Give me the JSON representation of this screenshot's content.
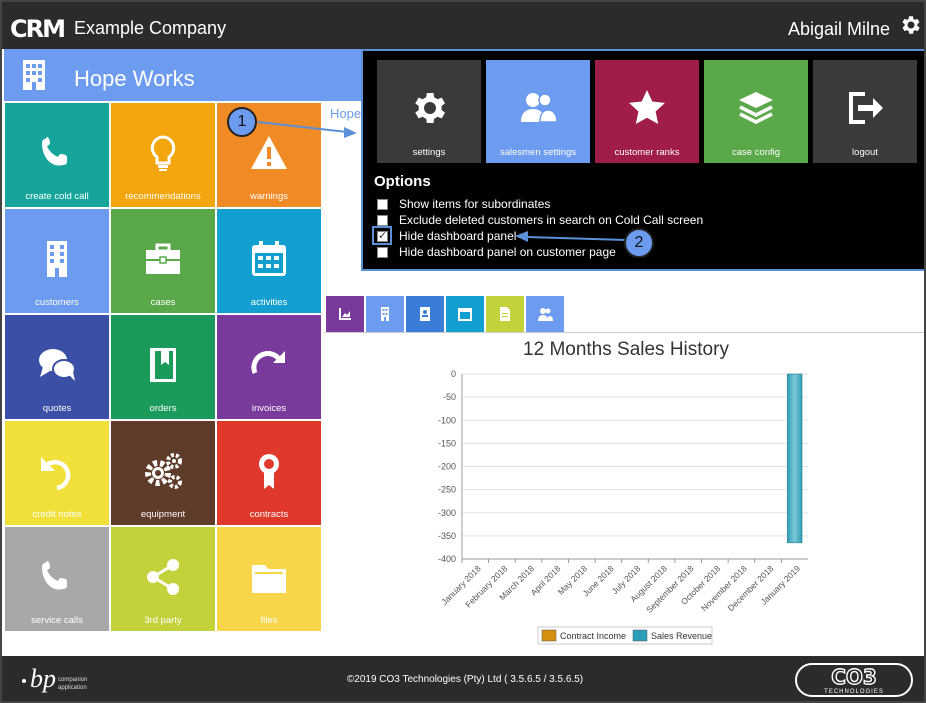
{
  "topbar": {
    "logo": "CRM",
    "company": "Example Company",
    "user": "Abigail Milne"
  },
  "dashboard": {
    "title": "Hope Works"
  },
  "tiles": [
    {
      "label": "create cold call",
      "color": "#16a59a",
      "icon": "phone-icon"
    },
    {
      "label": "recommendations",
      "color": "#f2a50c",
      "icon": "lightbulb-icon"
    },
    {
      "label": "warnings",
      "color": "#f08a24",
      "icon": "warning-icon"
    },
    {
      "label": "customers",
      "color": "#6c9bef",
      "icon": "building-icon"
    },
    {
      "label": "cases",
      "color": "#5ba84a",
      "icon": "briefcase-icon"
    },
    {
      "label": "activities",
      "color": "#139fcf",
      "icon": "calendar-icon"
    },
    {
      "label": "quotes",
      "color": "#3a4fa5",
      "icon": "chat-icon"
    },
    {
      "label": "orders",
      "color": "#1a9a5b",
      "icon": "book-icon"
    },
    {
      "label": "invoices",
      "color": "#7a3a9c",
      "icon": "redo-icon"
    },
    {
      "label": "credit notes",
      "color": "#f2e03a",
      "icon": "undo-icon"
    },
    {
      "label": "equipment",
      "color": "#5f3b2a",
      "icon": "gears-icon"
    },
    {
      "label": "contracts",
      "color": "#e0392b",
      "icon": "ribbon-icon"
    },
    {
      "label": "service calls",
      "color": "#a8a8a8",
      "icon": "phone-icon"
    },
    {
      "label": "3rd party",
      "color": "#c3d13b",
      "icon": "share-icon"
    },
    {
      "label": "files",
      "color": "#f7d64a",
      "icon": "folder-icon"
    }
  ],
  "breadcrumb": "Hope",
  "popup": {
    "tiles": [
      {
        "label": "settings",
        "color": "#3a3a3a",
        "icon": "gear-icon"
      },
      {
        "label": "salesmen settings",
        "color": "#6c9bef",
        "icon": "users-icon"
      },
      {
        "label": "customer ranks",
        "color": "#a01d4a",
        "icon": "star-icon"
      },
      {
        "label": "case config",
        "color": "#5ba84a",
        "icon": "layers-icon"
      },
      {
        "label": "logout",
        "color": "#3a3a3a",
        "icon": "logout-icon"
      }
    ],
    "options_title": "Options",
    "options": [
      {
        "label": "Show items for subordinates",
        "checked": false
      },
      {
        "label": "Exclude deleted customers in search on Cold Call screen",
        "checked": false
      },
      {
        "label": "Hide dashboard panel",
        "checked": true
      },
      {
        "label": "Hide dashboard panel on customer page",
        "checked": false
      }
    ]
  },
  "callouts": [
    "1",
    "2"
  ],
  "tabs": [
    {
      "color": "#7a3a9c",
      "icon": "chart-icon"
    },
    {
      "color": "#6c9bef",
      "icon": "building-icon"
    },
    {
      "color": "#3a7dd8",
      "icon": "contact-book-icon"
    },
    {
      "color": "#139fcf",
      "icon": "calendar-icon"
    },
    {
      "color": "#c3d13b",
      "icon": "document-icon"
    },
    {
      "color": "#6c9bef",
      "icon": "users-icon"
    }
  ],
  "chart_data": {
    "type": "bar",
    "title": "12 Months Sales History",
    "categories": [
      "January 2018",
      "February 2018",
      "March 2018",
      "April 2018",
      "May 2018",
      "June 2018",
      "July 2018",
      "August 2018",
      "September 2018",
      "October 2018",
      "November 2018",
      "December 2018",
      "January 2019"
    ],
    "series": [
      {
        "name": "Contract Income",
        "color": "#d4900f",
        "values": [
          0,
          0,
          0,
          0,
          0,
          0,
          0,
          0,
          0,
          0,
          0,
          0,
          0
        ]
      },
      {
        "name": "Sales Revenue",
        "color": "#2e9fb8",
        "values": [
          0,
          0,
          0,
          0,
          0,
          0,
          0,
          0,
          0,
          0,
          0,
          0,
          -365
        ]
      }
    ],
    "ylim": [
      -400,
      0
    ],
    "yticks": [
      "0",
      "-50",
      "-100",
      "-150",
      "-200",
      "-250",
      "-300",
      "-350",
      "-400"
    ],
    "grid": true,
    "legend": "bottom"
  },
  "footer": {
    "copyright": "©2019 CO3 Technologies (Pty) Ltd ( 3.5.6.5 / 3.5.6.5)",
    "left_logo": "bp",
    "left_logo_sub1": "companion",
    "left_logo_sub2": "application",
    "right_logo": "CO3",
    "right_logo_sub": "TECHNOLOGIES"
  }
}
